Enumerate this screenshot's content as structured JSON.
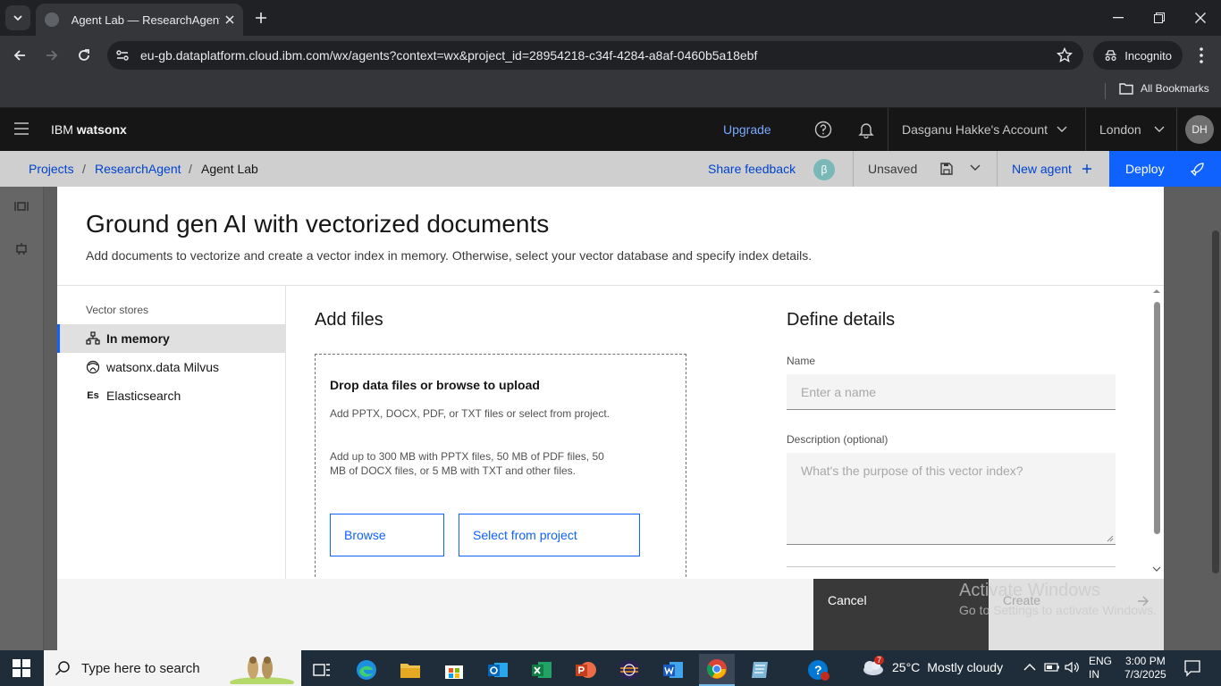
{
  "browser": {
    "tab_title": "Agent Lab — ResearchAgent | I",
    "url": "eu-gb.dataplatform.cloud.ibm.com/wx/agents?context=wx&project_id=28954218-c34f-4284-a8af-0460b5a18ebf",
    "incognito_label": "Incognito",
    "all_bookmarks_label": "All Bookmarks"
  },
  "header": {
    "brand_prefix": "IBM",
    "brand_name": "watsonx",
    "upgrade_label": "Upgrade",
    "account_label": "Dasganu Hakke's Account",
    "region_label": "London",
    "avatar_initials": "DH"
  },
  "toolbar": {
    "breadcrumbs": [
      "Projects",
      "ResearchAgent",
      "Agent Lab"
    ],
    "separator": "/",
    "share_feedback_label": "Share feedback",
    "beta_label": "β",
    "unsaved_label": "Unsaved",
    "new_agent_label": "New agent",
    "deploy_label": "Deploy"
  },
  "modal": {
    "title": "Ground gen AI with vectorized documents",
    "subtitle": "Add documents to vectorize and create a vector index in memory. Otherwise, select your vector database and specify index details.",
    "vector_stores_heading": "Vector stores",
    "vector_stores": [
      {
        "label": "In memory",
        "icon": "in-memory-icon",
        "selected": true
      },
      {
        "label": "watsonx.data Milvus",
        "icon": "milvus-icon",
        "selected": false
      },
      {
        "label": "Elasticsearch",
        "icon": "Es",
        "selected": false
      }
    ],
    "add_files": {
      "title": "Add files",
      "drop_title": "Drop data files or browse to upload",
      "drop_desc_1": "Add PPTX, DOCX, PDF, or TXT files or select from project.",
      "drop_desc_2": "Add up to 300 MB with PPTX files, 50 MB of PDF files, 50 MB of DOCX files, or 5 MB with TXT and other files.",
      "browse_label": "Browse",
      "select_label": "Select from project"
    },
    "define_details": {
      "title": "Define details",
      "name_label": "Name",
      "name_placeholder": "Enter a name",
      "description_label": "Description (optional)",
      "description_placeholder": "What's the purpose of this vector index?"
    },
    "cancel_label": "Cancel",
    "create_label": "Create"
  },
  "watermark": {
    "line1": "Activate Windows",
    "line2": "Go to Settings to activate Windows."
  },
  "taskbar": {
    "search_placeholder": "Type here to search",
    "weather_temp": "25°C",
    "weather_desc": "Mostly cloudy",
    "weather_badge": "7",
    "lang_line1": "ENG",
    "lang_line2": "IN",
    "time": "3:00 PM",
    "date": "7/3/2025"
  }
}
